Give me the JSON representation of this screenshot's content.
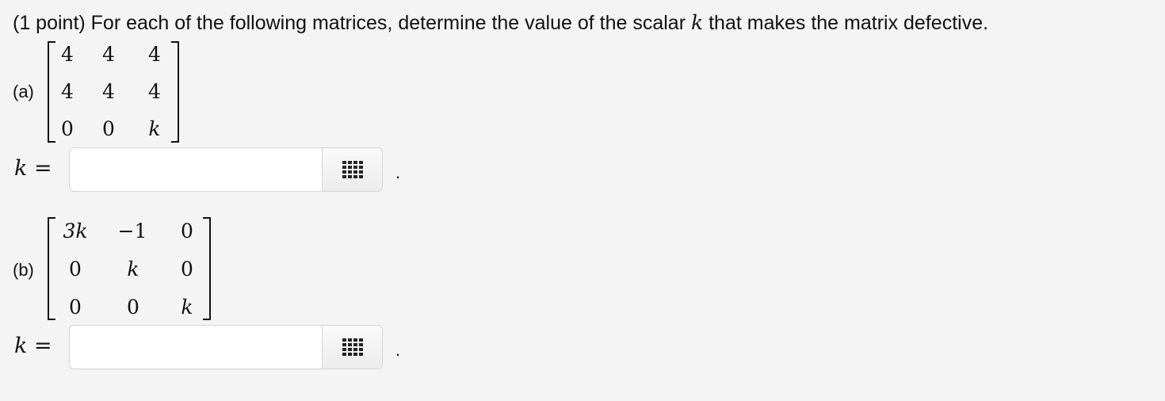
{
  "question": {
    "prefix": "(1 point) For each of the following matrices, determine the value of the scalar",
    "variable": "k",
    "suffix": "that makes the matrix defective."
  },
  "parts": [
    {
      "label": "(a)",
      "matrix": [
        [
          "4",
          "4",
          "4"
        ],
        [
          "4",
          "4",
          "4"
        ],
        [
          "0",
          "0",
          "k"
        ]
      ],
      "answer_label": "k =",
      "answer_value": "",
      "palette_icon": "math-palette-icon",
      "trailing": "."
    },
    {
      "label": "(b)",
      "matrix": [
        [
          "3k",
          "−1",
          "0"
        ],
        [
          "0",
          "k",
          "0"
        ],
        [
          "0",
          "0",
          "k"
        ]
      ],
      "answer_label": "k =",
      "answer_value": "",
      "palette_icon": "math-palette-icon",
      "trailing": "."
    }
  ]
}
